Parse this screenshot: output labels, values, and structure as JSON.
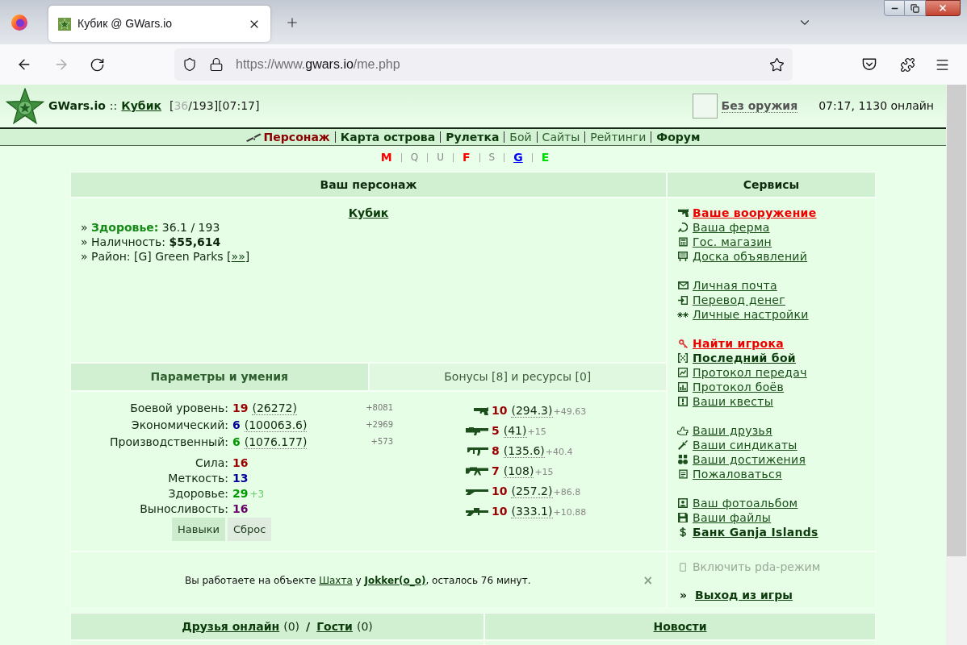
{
  "browser": {
    "tab_title": "Кубик @ GWars.io",
    "address": {
      "scheme": "https://www.",
      "domain": "gwars.io",
      "path": "/me.php"
    }
  },
  "header": {
    "site_name": "GWars.io",
    "separator": "::",
    "player": "Кубик",
    "health_open": "[",
    "health_current": "36",
    "health_rest": "/193][07:17]",
    "weapon": "Без оружия",
    "online": "07:17, 1130 онлайн"
  },
  "nav": [
    {
      "label": "Персонаж",
      "selected": true,
      "bold": true
    },
    {
      "label": "Карта острова",
      "selected": false,
      "bold": true
    },
    {
      "label": "Рулетка",
      "selected": false,
      "bold": true
    },
    {
      "label": "Бой",
      "selected": false,
      "bold": false
    },
    {
      "label": "Сайты",
      "selected": false,
      "bold": false
    },
    {
      "label": "Рейтинги",
      "selected": false,
      "bold": false
    },
    {
      "label": "Форум",
      "selected": false,
      "bold": true
    }
  ],
  "sectors": [
    {
      "label": "M",
      "color": "#ff0000",
      "active": true,
      "selected": false
    },
    {
      "label": "Q",
      "color": "#888888",
      "active": false,
      "selected": false
    },
    {
      "label": "U",
      "color": "#888888",
      "active": false,
      "selected": false
    },
    {
      "label": "F",
      "color": "#ff0000",
      "active": true,
      "selected": false
    },
    {
      "label": "S",
      "color": "#888888",
      "active": false,
      "selected": false
    },
    {
      "label": "G",
      "color": "#0000ff",
      "active": true,
      "selected": true
    },
    {
      "label": "E",
      "color": "#00dd00",
      "active": true,
      "selected": false
    }
  ],
  "character": {
    "title": "Ваш персонаж",
    "name": "Кубик",
    "lines": [
      {
        "kind": "health",
        "bullet": "»",
        "label": "Здоровье:",
        "value": "36.1 / 193"
      },
      {
        "kind": "cash",
        "bullet": "»",
        "label": "Наличность:",
        "value": "$55,614"
      },
      {
        "kind": "district",
        "bullet": "»",
        "label": "Район:",
        "value": "[G] Green Parks [",
        "link": "»»",
        "tail": "]"
      }
    ]
  },
  "services": {
    "title": "Сервисы",
    "groups": [
      [
        {
          "label": "Ваше вооружение",
          "kind": "alert"
        },
        {
          "label": "Ваша ферма",
          "kind": "plain"
        },
        {
          "label": "Гос. магазин",
          "kind": "plain"
        },
        {
          "label": "Доска объявлений",
          "kind": "plain"
        }
      ],
      [
        {
          "label": "Личная почта",
          "kind": "plain"
        },
        {
          "label": "Перевод денег",
          "kind": "plain"
        },
        {
          "label": "Личные настройки",
          "kind": "plain"
        }
      ],
      [
        {
          "label": "Найти игрока",
          "kind": "alert"
        },
        {
          "label": "Последний бой",
          "kind": "strong"
        },
        {
          "label": "Протокол передач",
          "kind": "plain"
        },
        {
          "label": "Протокол боёв",
          "kind": "plain"
        },
        {
          "label": "Ваши квесты",
          "kind": "plain"
        }
      ],
      [
        {
          "label": "Ваши друзья",
          "kind": "plain"
        },
        {
          "label": "Ваши синдикаты",
          "kind": "plain"
        },
        {
          "label": "Ваши достижения",
          "kind": "plain"
        },
        {
          "label": "Пожаловаться",
          "kind": "plain"
        }
      ],
      [
        {
          "label": "Ваш фотоальбом",
          "kind": "plain"
        },
        {
          "label": "Ваши файлы",
          "kind": "plain"
        },
        {
          "label": "Банк Ganja Islands",
          "kind": "strong"
        }
      ]
    ]
  },
  "params": {
    "tabs": [
      {
        "label": "Параметры и умения",
        "selected": true
      },
      {
        "label": "Бонусы [8] и ресурсы [0]",
        "selected": false
      }
    ],
    "levels": [
      {
        "label": "Боевой уровень:",
        "value": "19",
        "color": "#990000",
        "exp": "(26272)",
        "gain": "+8081"
      },
      {
        "label": "Экономический:",
        "value": "6",
        "color": "#000099",
        "exp": "(100063.6)",
        "gain": "+2969"
      },
      {
        "label": "Производственный:",
        "value": "6",
        "color": "#009900",
        "exp": "(1076.177)",
        "gain": "+573"
      }
    ],
    "attributes": [
      {
        "label": "Сила:",
        "value": "16",
        "color": "#990000"
      },
      {
        "label": "Меткость:",
        "value": "13",
        "color": "#000099"
      },
      {
        "label": "Здоровье:",
        "value": "29",
        "color": "#009900",
        "bonus": "+3"
      },
      {
        "label": "Выносливость:",
        "value": "16",
        "color": "#660066"
      }
    ],
    "buttons": [
      {
        "label": "Навыки",
        "kind": "primary"
      },
      {
        "label": "Сброс",
        "kind": "secondary"
      }
    ],
    "weapon_skills": [
      {
        "value": "10",
        "exp": "(294.3)",
        "gain": "+49.63"
      },
      {
        "value": "5",
        "exp": "(41)",
        "gain": "+15"
      },
      {
        "value": "8",
        "exp": "(135.6)",
        "gain": "+40.4"
      },
      {
        "value": "7",
        "exp": "(108)",
        "gain": "+15"
      },
      {
        "value": "10",
        "exp": "(257.2)",
        "gain": "+86.8"
      },
      {
        "value": "10",
        "exp": "(333.1)",
        "gain": "+10.88"
      }
    ]
  },
  "work": {
    "text_before": "Вы работаете на объекте",
    "place": "Шахта",
    "middle": "у",
    "employer": "Jokker(o_o)",
    "text_after": ", осталось 76 минут.",
    "close": "×"
  },
  "pda": {
    "label": "Включить pda-режим",
    "on": false
  },
  "logout": {
    "marker": "»",
    "label": "Выход из игры"
  },
  "footer": {
    "friends": {
      "label": "Друзья онлайн",
      "count": "(0)"
    },
    "slash": "/",
    "guests": {
      "label": "Гости",
      "count": "(0)"
    },
    "news": "Новости"
  }
}
